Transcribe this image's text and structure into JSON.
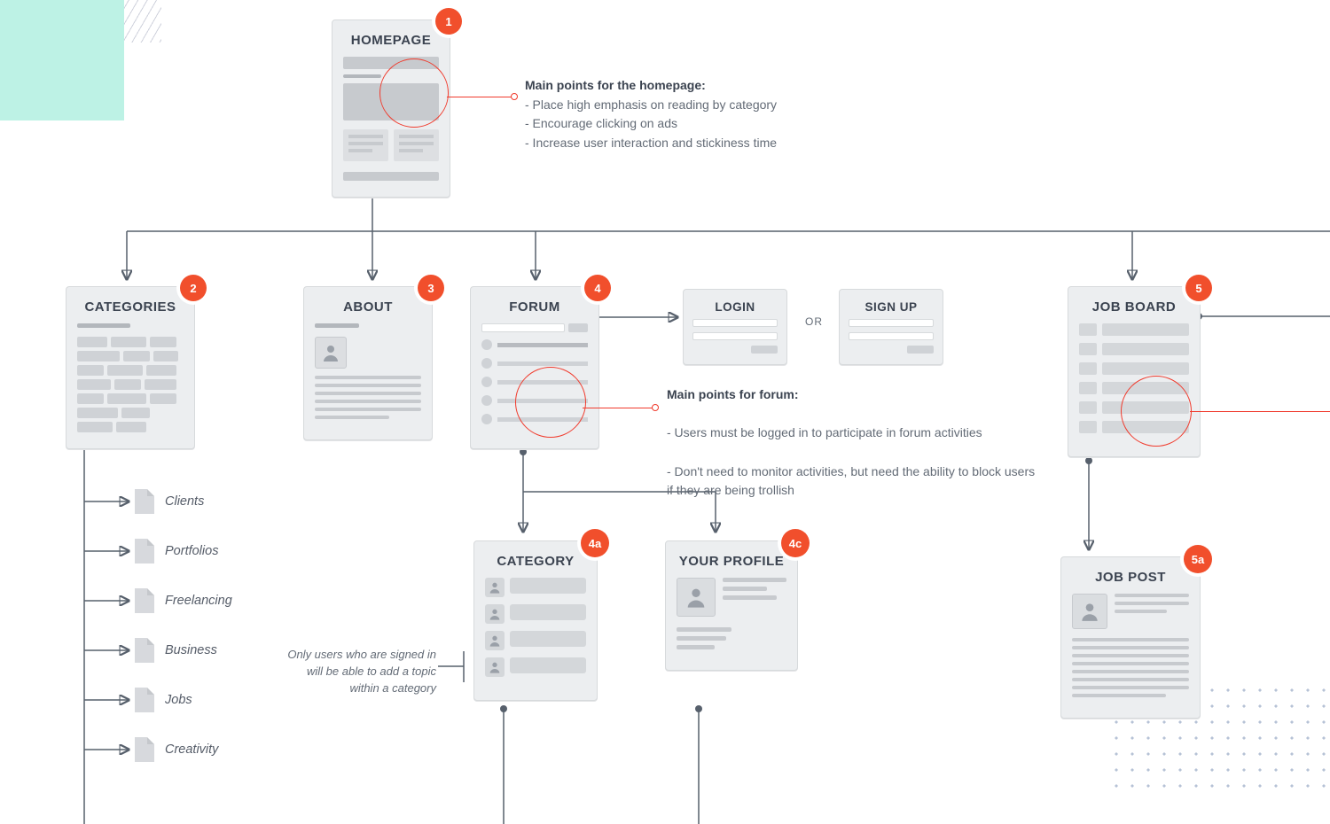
{
  "nodes": {
    "homepage": {
      "badge": "1",
      "title": "HOMEPAGE"
    },
    "categories": {
      "badge": "2",
      "title": "CATEGORIES"
    },
    "about": {
      "badge": "3",
      "title": "ABOUT"
    },
    "forum": {
      "badge": "4",
      "title": "FORUM"
    },
    "login": {
      "title": "LOGIN"
    },
    "signup": {
      "title": "SIGN UP"
    },
    "orLabel": "OR",
    "jobboard": {
      "badge": "5",
      "title": "JOB BOARD"
    },
    "category": {
      "badge": "4a",
      "title": "CATEGORY"
    },
    "profile": {
      "badge": "4c",
      "title": "YOUR PROFILE"
    },
    "jobpost": {
      "badge": "5a",
      "title": "JOB POST"
    }
  },
  "annotations": {
    "homepage": {
      "heading": "Main points for the homepage:",
      "bullets": [
        "- Place high emphasis on reading by category",
        "- Encourage clicking on ads",
        "- Increase user interaction and stickiness time"
      ]
    },
    "forum": {
      "heading": "Main points for forum:",
      "bullets": [
        "- Users must be logged in to participate in forum activities",
        "- Don't need to monitor activities, but need the ability to block users if they are being trollish"
      ]
    },
    "categoryNote": {
      "lines": [
        "Only users who are signed in",
        "will be able to add a topic",
        "within a category"
      ]
    }
  },
  "categoryPages": [
    "Clients",
    "Portfolios",
    "Freelancing",
    "Business",
    "Jobs",
    "Creativity"
  ]
}
